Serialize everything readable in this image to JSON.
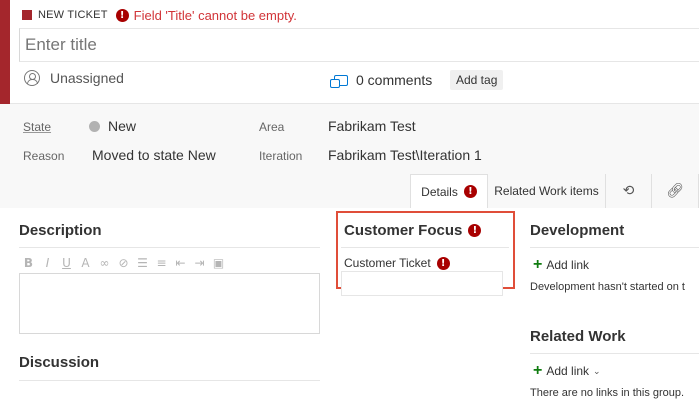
{
  "header": {
    "work_item_type": "NEW TICKET",
    "error_message": "Field 'Title' cannot be empty.",
    "title_placeholder": "Enter title",
    "assigned_to": "Unassigned",
    "comments_label": "0 comments",
    "add_tag_label": "Add tag",
    "accent_color": "#a4262c"
  },
  "fields": {
    "state_label": "State",
    "state_value": "New",
    "reason_label": "Reason",
    "reason_value": "Moved to state New",
    "area_label": "Area",
    "area_value": "Fabrikam Test",
    "iteration_label": "Iteration",
    "iteration_value": "Fabrikam Test\\Iteration 1"
  },
  "tabs": [
    {
      "label": "Details",
      "active": true,
      "has_error": true
    },
    {
      "label": "Related Work items",
      "active": false
    },
    {
      "icon": "history-icon"
    },
    {
      "icon": "link-icon"
    }
  ],
  "description": {
    "title": "Description",
    "toolbar": [
      "bold-icon",
      "italic-icon",
      "underline-icon",
      "format-icon",
      "link-icon",
      "unlink-icon",
      "bullet-list-icon",
      "numbered-list-icon",
      "outdent-icon",
      "indent-icon",
      "image-icon"
    ]
  },
  "discussion": {
    "title": "Discussion"
  },
  "customer_focus": {
    "title": "Customer Focus",
    "field_label": "Customer Ticket",
    "highlight_color": "#e04e39"
  },
  "development": {
    "title": "Development",
    "add_link": "Add link",
    "status": "Development hasn't started on t"
  },
  "related_work": {
    "title": "Related Work",
    "add_link": "Add link",
    "status": "There are no links in this group."
  }
}
